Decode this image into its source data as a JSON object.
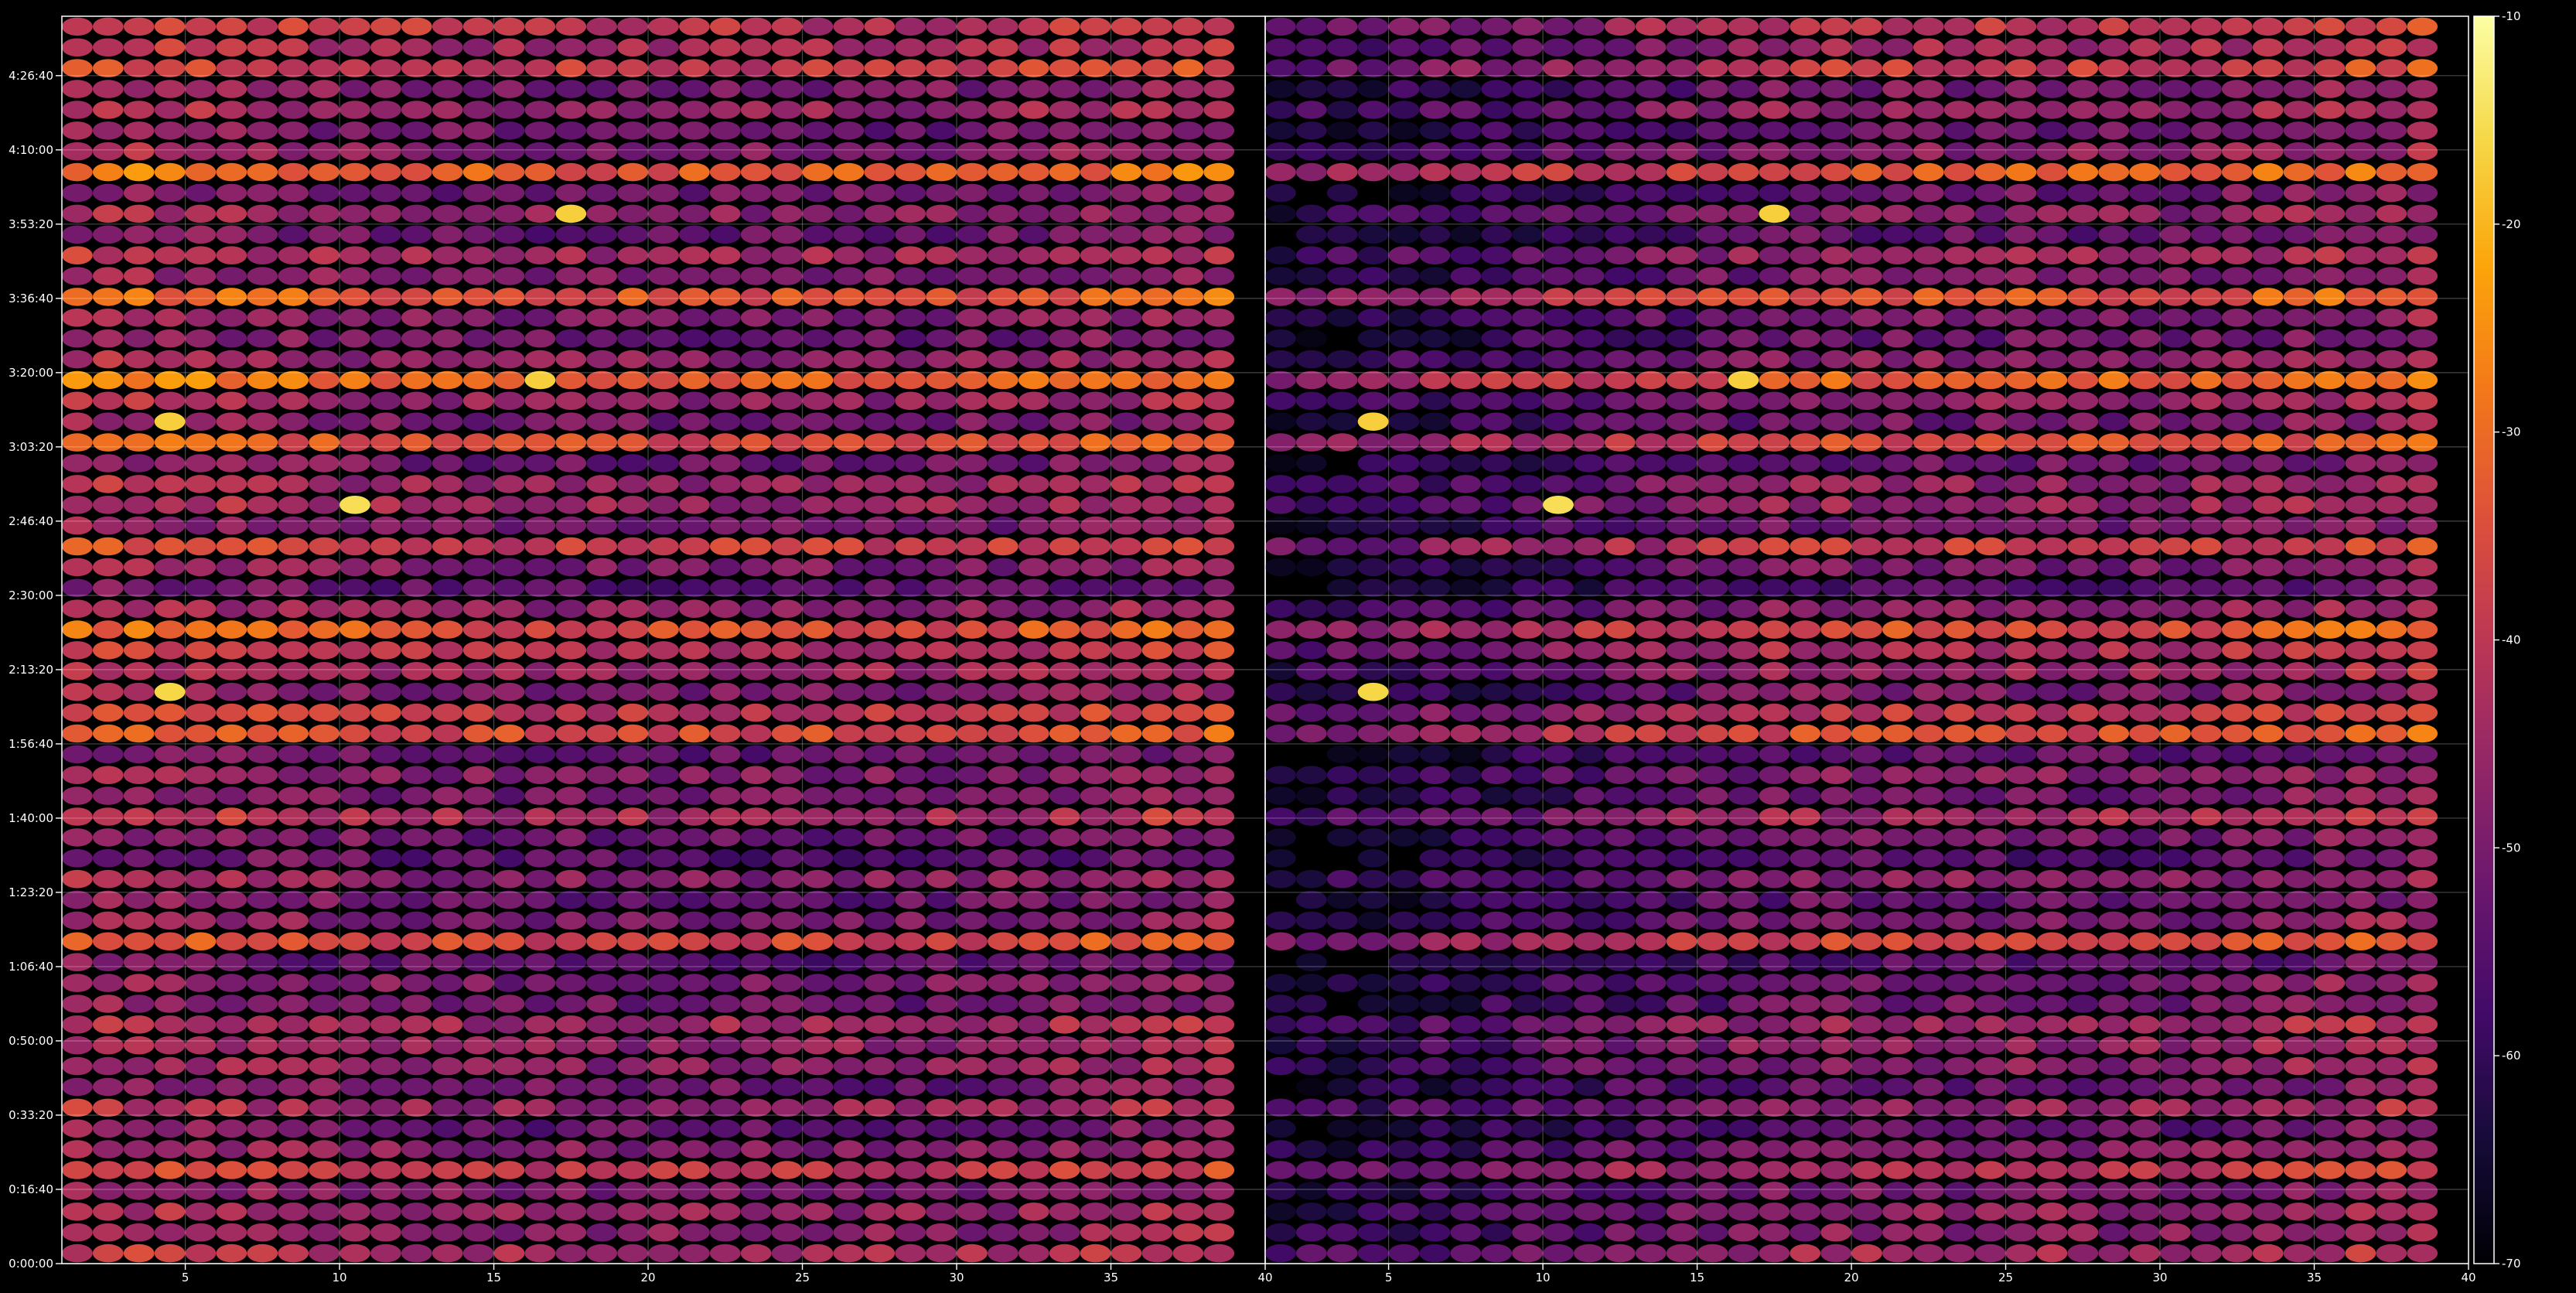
{
  "chart_data": {
    "type": "heatmap",
    "title": "",
    "xlabel": "",
    "ylabel": "",
    "colormap": "inferno",
    "colors": {
      "background": "#000000",
      "axes": "#ffffff",
      "grid": "#ffffff"
    },
    "grid": true,
    "panels": [
      {
        "name": "",
        "xlim": [
          1,
          40
        ],
        "x_ticks": [
          "5",
          "10",
          "15",
          "20",
          "25",
          "30",
          "35",
          "40"
        ],
        "x_tick_values": [
          5,
          10,
          15,
          20,
          25,
          30,
          35,
          40
        ]
      },
      {
        "name": "",
        "xlim": [
          1,
          40
        ],
        "x_ticks": [
          "5",
          "10",
          "15",
          "20",
          "25",
          "30",
          "35",
          "40"
        ],
        "x_tick_values": [
          5,
          10,
          15,
          20,
          25,
          30,
          35,
          40
        ]
      }
    ],
    "y_axis": {
      "ylim_seconds": [
        0,
        16800
      ],
      "ticks": [
        "0:00:00",
        "0:16:40",
        "0:33:20",
        "0:50:00",
        "1:06:40",
        "1:23:20",
        "1:40:00",
        "1:56:40",
        "2:13:20",
        "2:30:00",
        "2:46:40",
        "3:03:20",
        "3:20:00",
        "3:36:40",
        "3:53:20",
        "4:10:00",
        "4:26:40"
      ],
      "tick_seconds": [
        0,
        1000,
        2000,
        3000,
        4000,
        5000,
        6000,
        7000,
        8000,
        9000,
        10000,
        11000,
        12000,
        13000,
        14000,
        15000,
        16000
      ]
    },
    "colorbar": {
      "range": [
        -70,
        -10
      ],
      "ticks": [
        "-10",
        "-20",
        "-30",
        "-40",
        "-50",
        "-60",
        "-70"
      ],
      "tick_values": [
        -10,
        -20,
        -30,
        -40,
        -50,
        -60,
        -70
      ]
    },
    "time_rows": 60,
    "channels": 38,
    "channel_start": 1.5,
    "channel_step": 1.0,
    "row_step_seconds": 280,
    "row_level_dB": [
      -44,
      -48,
      -47,
      -50,
      -41,
      -49,
      -53,
      -46,
      -52,
      -48,
      -47,
      -45,
      -52,
      -50,
      -55,
      -37,
      -50,
      -53,
      -48,
      -55,
      -52,
      -44,
      -51,
      -49,
      -54,
      -36,
      -40,
      -50,
      -46,
      -42,
      -35,
      -48,
      -55,
      -50,
      -39,
      -51,
      -46,
      -47,
      -52,
      -36,
      -51,
      -47,
      -32,
      -48,
      -52,
      -50,
      -34,
      -50,
      -45,
      -53,
      -48,
      -52,
      -33,
      -48,
      -52,
      -46,
      -50,
      -39,
      -44,
      -41
    ],
    "hotspots": [
      {
        "row": 36,
        "ch": 9,
        "v": -15
      },
      {
        "row": 42,
        "ch": 15,
        "v": -17
      },
      {
        "row": 27,
        "ch": 3,
        "v": -16
      },
      {
        "row": 40,
        "ch": 3,
        "v": -17
      },
      {
        "row": 50,
        "ch": 16,
        "v": -17
      }
    ]
  }
}
